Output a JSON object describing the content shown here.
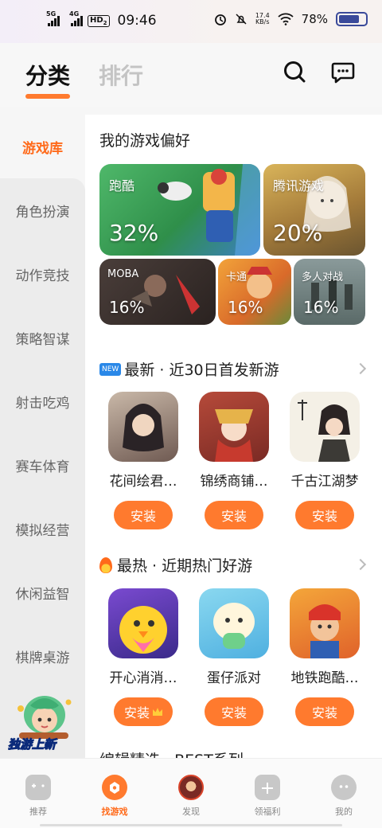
{
  "status_bar": {
    "signal_1": "5G",
    "signal_2": "4G",
    "hd": "HD",
    "hd_sub": "2",
    "time": "09:46",
    "net_speed_value": "17.4",
    "net_speed_unit": "KB/s",
    "battery": "78%",
    "battery_level": 0.78
  },
  "header": {
    "tab_active": "分类",
    "tab_other": "排行",
    "icons": [
      "search-icon",
      "message-icon"
    ]
  },
  "sidebar": {
    "items": [
      {
        "label": "游戏库",
        "active": true
      },
      {
        "label": "角色扮演"
      },
      {
        "label": "动作竞技"
      },
      {
        "label": "策略智谋"
      },
      {
        "label": "射击吃鸡"
      },
      {
        "label": "赛车体育"
      },
      {
        "label": "模拟经营"
      },
      {
        "label": "休闲益智"
      },
      {
        "label": "棋牌桌游"
      }
    ],
    "promo_text": "独游上新"
  },
  "preferences": {
    "title": "我的游戏偏好",
    "cards": [
      {
        "name": "跑酷",
        "percent": "32%"
      },
      {
        "name": "腾讯游戏",
        "percent": "20%"
      },
      {
        "name": "MOBA",
        "percent": "16%"
      },
      {
        "name": "卡通",
        "percent": "16%"
      },
      {
        "name": "多人对战",
        "percent": "16%"
      }
    ]
  },
  "section_new": {
    "badge": "NEW",
    "title": "最新 · 近30日首发新游",
    "games": [
      {
        "name": "花间绘君…",
        "button": "安装"
      },
      {
        "name": "锦绣商铺…",
        "button": "安装"
      },
      {
        "name": "千古江湖梦",
        "button": "安装"
      }
    ]
  },
  "section_hot": {
    "title": "最热 · 近期热门好游",
    "games": [
      {
        "name": "开心消消…",
        "button": "安装",
        "crown": true
      },
      {
        "name": "蛋仔派对",
        "button": "安装"
      },
      {
        "name": "地铁跑酷…",
        "button": "安装"
      }
    ]
  },
  "section_next": {
    "title": "编辑精选 · BEST系列"
  },
  "bottom_nav": {
    "items": [
      {
        "label": "推荐"
      },
      {
        "label": "找游戏",
        "active": true
      },
      {
        "label": "发现"
      },
      {
        "label": "领福利"
      },
      {
        "label": "我的"
      }
    ]
  },
  "colors": {
    "accent": "#ff7a2e",
    "active_text": "#ff6a1a"
  }
}
